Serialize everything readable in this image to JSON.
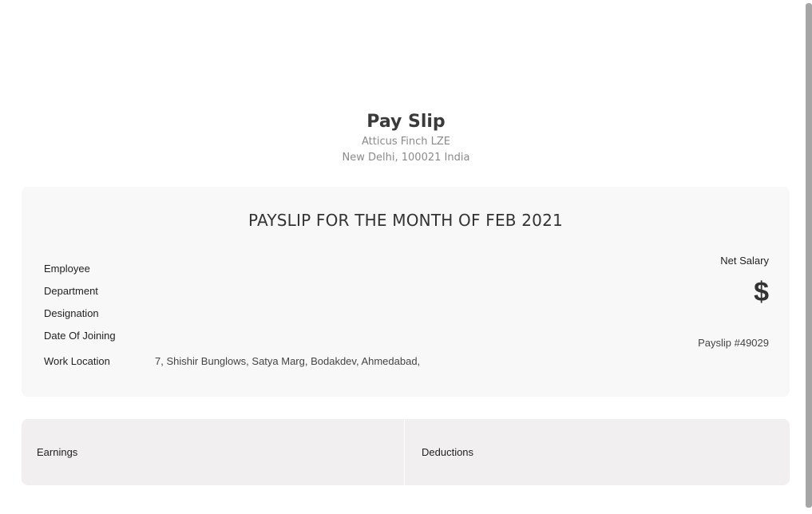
{
  "header": {
    "title": "Pay Slip",
    "company": "Atticus Finch LZE",
    "address": "New Delhi, 100021 India"
  },
  "info": {
    "month_title": "PAYSLIP FOR THE MONTH OF FEB 2021",
    "fields": {
      "employee_label": "Employee",
      "employee_value": "",
      "department_label": "Department",
      "department_value": "",
      "designation_label": "Designation",
      "designation_value": "",
      "doj_label": "Date Of Joining",
      "doj_value": "",
      "work_location_label": "Work Location",
      "work_location_value": "7, Shishir Bunglows, Satya Marg, Bodakdev, Ahmedabad,"
    },
    "net_salary_label": "Net Salary",
    "net_salary_value": "$",
    "payslip_number": "Payslip #49029"
  },
  "table": {
    "earnings_label": "Earnings",
    "deductions_label": "Deductions"
  }
}
